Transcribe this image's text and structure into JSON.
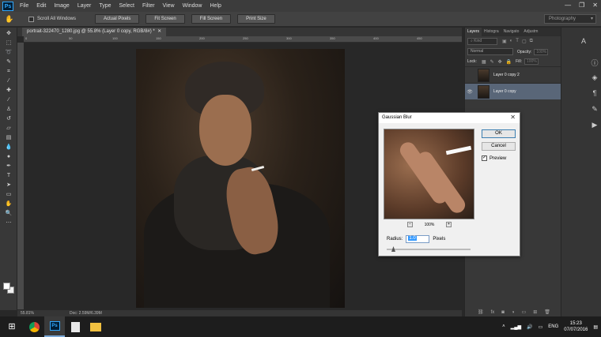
{
  "app": {
    "logo": "Ps",
    "menu": [
      "File",
      "Edit",
      "Image",
      "Layer",
      "Type",
      "Select",
      "Filter",
      "View",
      "Window",
      "Help"
    ],
    "window_controls": [
      "—",
      "❐",
      "✕"
    ]
  },
  "options_bar": {
    "scroll_all_windows": "Scroll All Windows",
    "buttons": [
      "Actual Pixels",
      "Fit Screen",
      "Fill Screen",
      "Print Size"
    ],
    "workspace": "Photography"
  },
  "document": {
    "tab_title": "portrait-322470_1280.jpg @ 55.8% (Layer 0 copy, RGB/8#) *",
    "ruler_marks": [
      "0",
      "50",
      "100",
      "150",
      "200",
      "250",
      "300",
      "350",
      "400",
      "450",
      "500",
      "550"
    ],
    "status_zoom": "55.81%",
    "status_doc": "Doc: 2.59M/6.39M"
  },
  "layers_panel": {
    "tabs": [
      "Layers",
      "Histogra",
      "Navigato",
      "Adjustm"
    ],
    "kind_placeholder": "Kind",
    "blend_mode": "Normal",
    "opacity_label": "Opacity:",
    "opacity_value": "100%",
    "lock_label": "Lock:",
    "fill_label": "Fill:",
    "fill_value": "100%",
    "layers": [
      {
        "name": "Layer 0 copy 2",
        "visible": false,
        "selected": false
      },
      {
        "name": "Layer 0 copy",
        "visible": true,
        "selected": true
      }
    ]
  },
  "dialog": {
    "title": "Gaussian Blur",
    "ok": "OK",
    "cancel": "Cancel",
    "preview_label": "Preview",
    "preview_checked": true,
    "zoom": "100%",
    "radius_label": "Radius:",
    "radius_value": "1.0",
    "radius_unit": "Pixels"
  },
  "taskbar": {
    "language": "ENG",
    "time": "15:23",
    "date": "07/07/2016"
  },
  "colors": {
    "foreground": "#ffffff",
    "background": "#f0f0f0",
    "selected_layer": "#596678"
  }
}
